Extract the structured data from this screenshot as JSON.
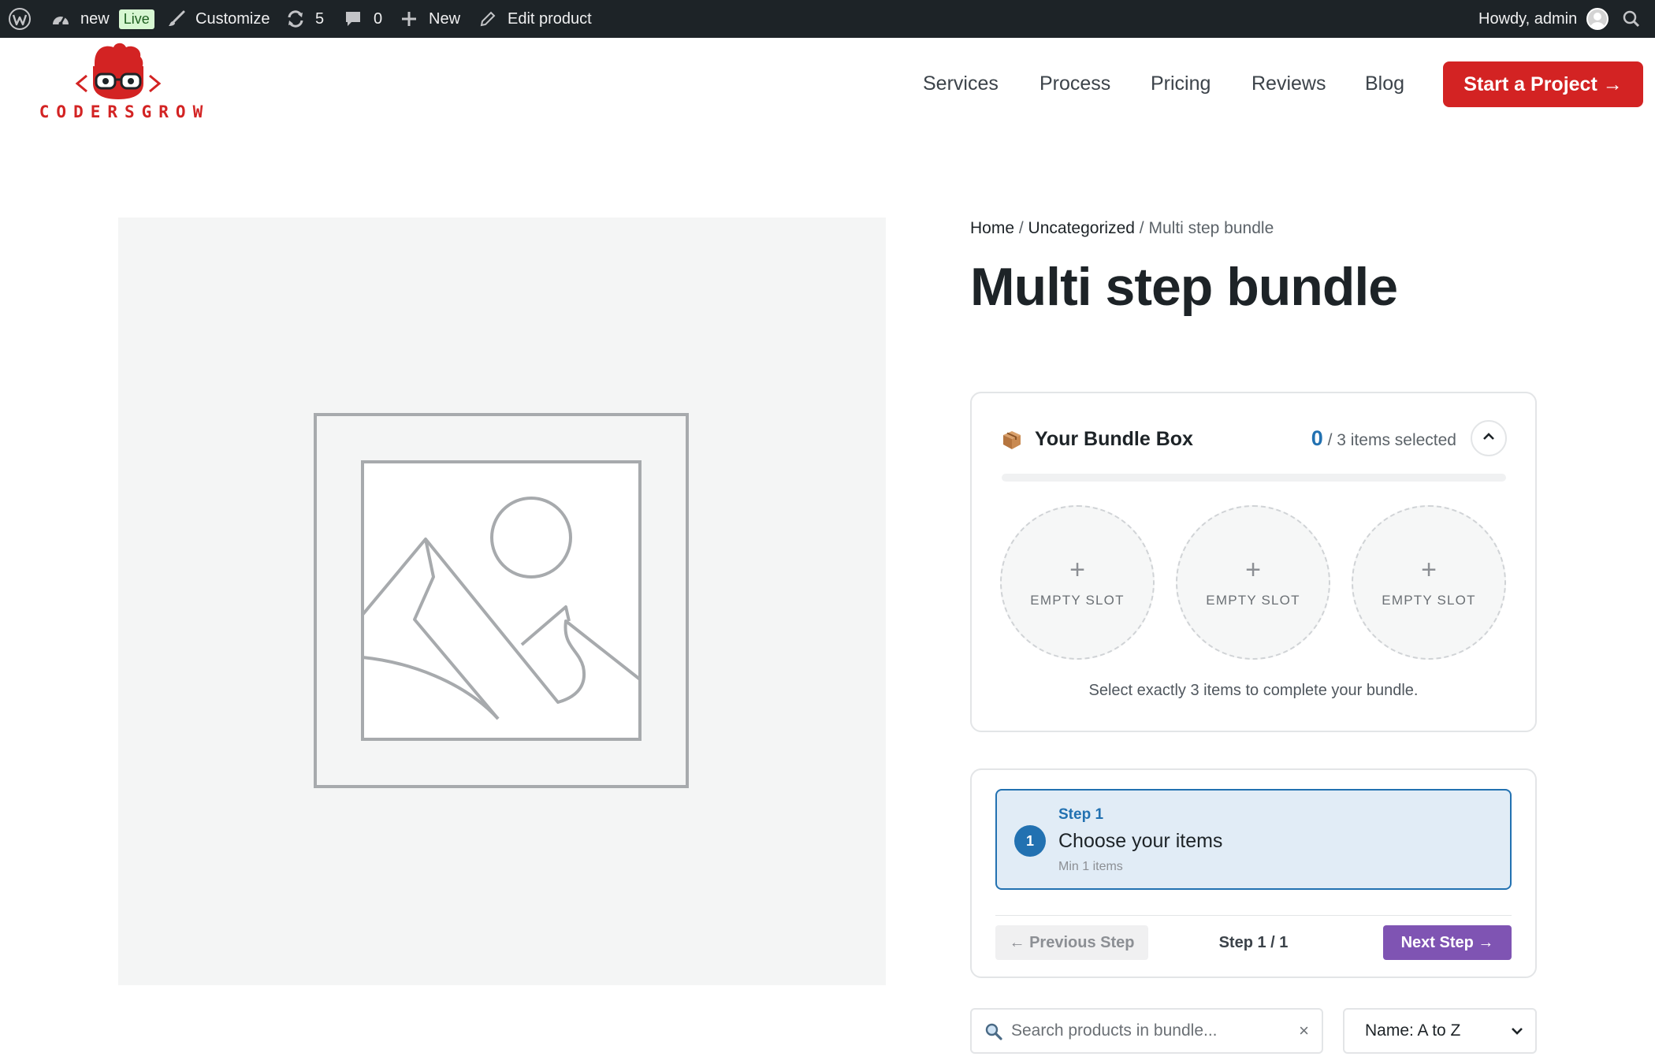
{
  "adminbar": {
    "wp_logo_icon": "wordpress-icon",
    "site_name": "new",
    "live_badge": "Live",
    "customize": "Customize",
    "updates_count": "5",
    "comments_count": "0",
    "new_label": "New",
    "edit_label": "Edit product",
    "howdy": "Howdy, admin"
  },
  "header": {
    "logo_text": "CODERSGROW",
    "nav": [
      "Services",
      "Process",
      "Pricing",
      "Reviews",
      "Blog"
    ],
    "cta": "Start a Project →"
  },
  "breadcrumb": {
    "home": "Home",
    "sep": " / ",
    "category": "Uncategorized",
    "current": "Multi step bundle"
  },
  "product": {
    "title": "Multi step bundle"
  },
  "bundle_box": {
    "title": "Your Bundle Box",
    "selected_count": "0",
    "selected_suffix": " / 3 items selected",
    "progress": 0,
    "slots": [
      {
        "plus": "+",
        "label": "EMPTY SLOT"
      },
      {
        "plus": "+",
        "label": "EMPTY SLOT"
      },
      {
        "plus": "+",
        "label": "EMPTY SLOT"
      }
    ],
    "hint": "Select exactly 3 items to complete your bundle."
  },
  "steps": {
    "current_number": "1",
    "kicker": "Step 1",
    "title": "Choose your items",
    "subtitle": "Min 1 items",
    "prev_label": "← Previous Step",
    "indicator": "Step 1 / 1",
    "next_label": "Next Step →"
  },
  "search": {
    "placeholder": "Search products in bundle...",
    "clear": "×"
  },
  "sort": {
    "selected": "Name: A to Z"
  },
  "colors": {
    "brand_red": "#d32323",
    "accent_blue": "#2271b1",
    "accent_purple": "#7f54b3",
    "adminbar_bg": "#1d2327"
  }
}
